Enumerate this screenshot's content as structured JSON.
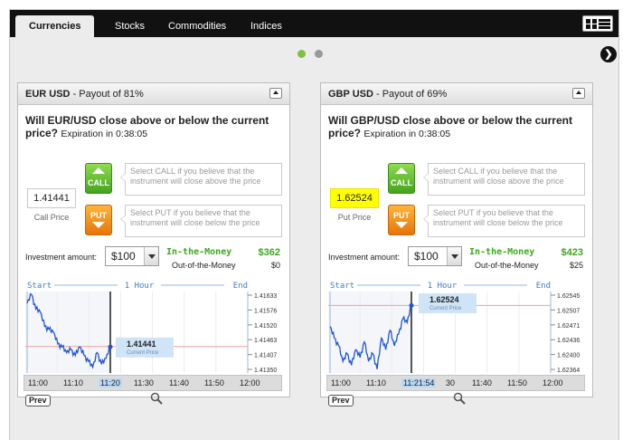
{
  "tabs": [
    {
      "label": "Currencies",
      "active": true
    },
    {
      "label": "Stocks",
      "active": false
    },
    {
      "label": "Commodities",
      "active": false
    },
    {
      "label": "Indices",
      "active": false
    }
  ],
  "pager": {
    "dots": [
      {
        "active": true,
        "color": "#7cc242"
      },
      {
        "active": false,
        "color": "#9a9a9a"
      }
    ]
  },
  "icons": {
    "view_toggle": "grid-list-toggle-icon",
    "next": "chevron-right-icon",
    "collapse": "collapse-icon",
    "zoom": "magnifier-icon"
  },
  "panels": [
    {
      "pair": "EUR USD",
      "payout": " - Payout of 81%",
      "question": "Will EUR/USD close above or below the current price?",
      "expiration": "Expiration in 0:38:05",
      "price": "1.41441",
      "price_label": "Call Price",
      "price_highlight": false,
      "call_label": "CALL",
      "put_label": "PUT",
      "call_hint": "Select CALL if you believe that the instrument will close above the price",
      "put_hint": "Select PUT if you believe that the instrument will close below the price",
      "investment_label": "Investment amount:",
      "investment_value": "$100",
      "itm_label": "In-the-Money",
      "itm_value": "$362",
      "otm_label": "Out-of-the-Money",
      "otm_value": "$0",
      "chart_start": "Start",
      "chart_period": "1 Hour",
      "chart_end": "End",
      "y_ticks": [
        "1.41633",
        "1.41576",
        "1.41520",
        "1.41463",
        "1.41407",
        "1.41350"
      ],
      "current_price": "1.41441",
      "current_label": "Current Price",
      "x_ticks": [
        "11:00",
        "11:10",
        "11:20",
        "11:30",
        "11:40",
        "11:50",
        "12:00"
      ],
      "highlight_tick": 2,
      "prev_label": "Prev",
      "chart_data": {
        "type": "line",
        "series": [
          {
            "values": [
              1.4159,
              1.4162,
              1.4157,
              1.4156,
              1.4151,
              1.415,
              1.4149,
              1.4145,
              1.4144,
              1.4142,
              1.4143,
              1.4141,
              1.4144,
              1.4141,
              1.4139,
              1.4137,
              1.4142,
              1.4138,
              1.414,
              1.4144
            ]
          }
        ],
        "x_range": [
          "11:00",
          "11:20"
        ],
        "ylim": [
          1.4135,
          1.4163
        ]
      }
    },
    {
      "pair": "GBP USD",
      "payout": " - Payout of 69%",
      "question": "Will GBP/USD close above or below the current price?",
      "expiration": "Expiration in 0:38:05",
      "price": "1.62524",
      "price_label": "Put Price",
      "price_highlight": true,
      "call_label": "CALL",
      "put_label": "PUT",
      "call_hint": "Select CALL if you believe that the instrument will close above the price",
      "put_hint": "Select PUT if you believe that the instrument will close below the price",
      "investment_label": "Investment amount:",
      "investment_value": "$100",
      "itm_label": "In-the-Money",
      "itm_value": "$423",
      "otm_label": "Out-of-the-Money",
      "otm_value": "$25",
      "chart_start": "Start",
      "chart_period": "1 Hour",
      "chart_end": "End",
      "y_ticks": [
        "1.62545",
        "1.62507",
        "1.62471",
        "1.62436",
        "1.62400",
        "1.62364"
      ],
      "current_price": "1.62524",
      "current_label": "Current Price",
      "x_ticks": [
        "11:00",
        "11:10",
        "11:21:54",
        "30",
        "11:40",
        "11:50",
        "12:00"
      ],
      "highlight_tick": 2,
      "prev_label": "Prev",
      "chart_data": {
        "type": "line",
        "series": [
          {
            "values": [
              1.6247,
              1.6244,
              1.6242,
              1.6238,
              1.624,
              1.6237,
              1.6241,
              1.6239,
              1.6243,
              1.6238,
              1.624,
              1.6236,
              1.6244,
              1.6241,
              1.6246,
              1.6242,
              1.6245,
              1.6249,
              1.6248,
              1.62524
            ]
          }
        ],
        "x_range": [
          "11:00",
          "11:21:54"
        ],
        "ylim": [
          1.6235,
          1.6256
        ]
      }
    }
  ]
}
